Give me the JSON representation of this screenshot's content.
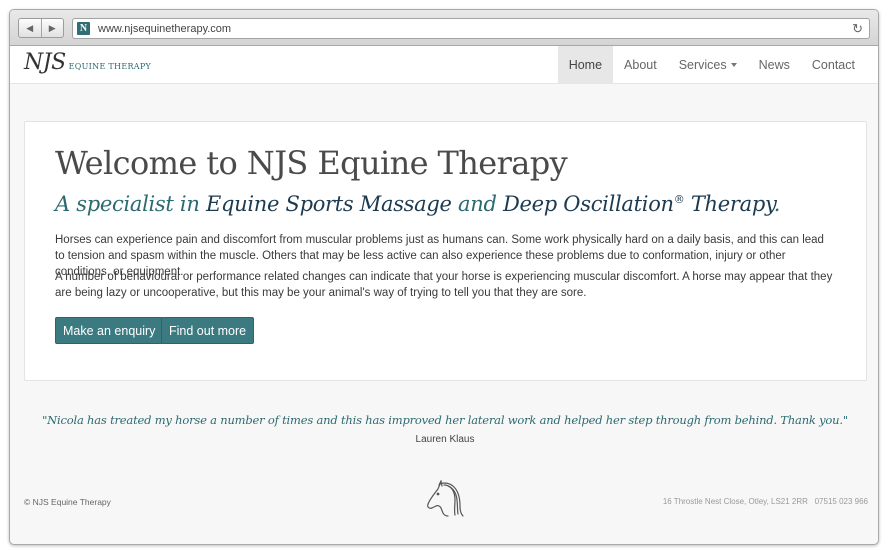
{
  "browser": {
    "back_icon": "back-arrow-icon",
    "forward_icon": "forward-arrow-icon",
    "favicon_letter": "N",
    "url": "www.njsequinetherapy.com",
    "reload_icon": "reload-icon"
  },
  "navbar": {
    "brand_main": "NJS",
    "brand_sub": "EQUINE THERAPY",
    "items": [
      {
        "label": "Home",
        "active": true
      },
      {
        "label": "About"
      },
      {
        "label": "Services",
        "dropdown": true
      },
      {
        "label": "News"
      },
      {
        "label": "Contact"
      }
    ]
  },
  "hero": {
    "title": "Welcome to NJS Equine Therapy",
    "tagline_part1": "A specialist in ",
    "tagline_part2": "Equine Sports Massage",
    "tagline_part3": " and ",
    "tagline_part4": "Deep Oscillation",
    "tagline_reg": "®",
    "tagline_part5": " Therapy",
    "tagline_period": ".",
    "paragraph1": "Horses can experience pain and discomfort from muscular problems just as humans can. Some work physically hard on a daily basis, and this can lead to tension and spasm within the muscle. Others that may be less active can also experience these problems due to conformation, injury or other conditions, or equipment.",
    "paragraph2": "A number of behavioural or performance related changes can indicate that your horse is experiencing muscular discomfort. A horse may appear that they are being lazy or uncooperative, but this may be your animal's way of trying to tell you that they are sore.",
    "button_enquiry": "Make an enquiry",
    "button_more": "Find out more"
  },
  "testimonial": {
    "quote": "\"Nicola has treated my horse a number of times and this has improved her lateral work and helped her step through from behind. Thank you.\"",
    "author": "Lauren Klaus"
  },
  "footer": {
    "copyright": "© NJS Equine Therapy",
    "logo_icon": "horse-head-icon",
    "address": "16 Throstle Nest Close, Otley, LS21 2RR",
    "phone": "07515 023 966"
  },
  "colors": {
    "accent": "#2b6a70",
    "button": "#3a7a80",
    "dark_text": "#1c3a50"
  }
}
